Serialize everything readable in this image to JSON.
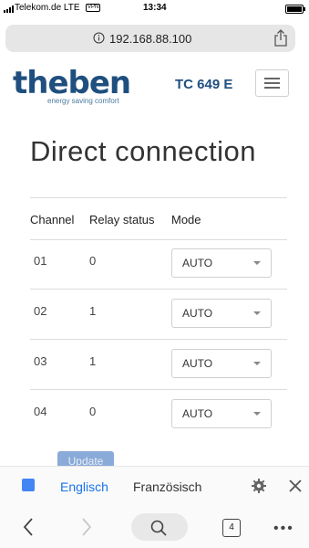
{
  "status_bar": {
    "carrier": "Telekom.de",
    "network": "LTE",
    "vpn": "VPN",
    "time": "13:34"
  },
  "browser": {
    "url": "192.168.88.100"
  },
  "header": {
    "logo_text": "theben",
    "logo_tagline": "energy saving comfort",
    "model": "TC 649 E"
  },
  "main": {
    "title": "Direct connection",
    "columns": [
      "Channel",
      "Relay status",
      "Mode"
    ],
    "rows": [
      {
        "channel": "01",
        "relay": "0",
        "mode": "AUTO"
      },
      {
        "channel": "02",
        "relay": "1",
        "mode": "AUTO"
      },
      {
        "channel": "03",
        "relay": "1",
        "mode": "AUTO"
      },
      {
        "channel": "04",
        "relay": "0",
        "mode": "AUTO"
      }
    ],
    "update_label": "Update"
  },
  "translate_bar": {
    "source_lang": "Englisch",
    "target_lang": "Französisch"
  },
  "toolbar": {
    "tab_count": "4",
    "more": "•••"
  }
}
